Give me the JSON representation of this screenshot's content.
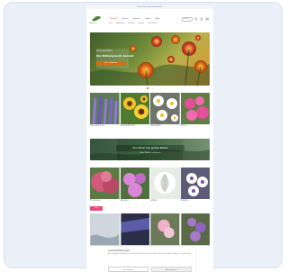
{
  "topbar": {
    "text": "Kostenloser Versand ab 50€"
  },
  "header": {
    "logo_text": "Gärtnerei",
    "nav": [
      {
        "label": "Pflanzen",
        "active": true
      },
      {
        "label": "Samen",
        "active": false
      },
      {
        "label": "Zubehör",
        "active": false
      },
      {
        "label": "Garten",
        "active": false
      },
      {
        "label": "Blog",
        "active": false
      }
    ],
    "subnav": [
      {
        "label": "Neu"
      },
      {
        "label": "Angebote"
      },
      {
        "label": "Beliebt"
      },
      {
        "label": "Saison"
      },
      {
        "label": "Geschenke"
      }
    ],
    "search_placeholder": "Suche…"
  },
  "hero": {
    "subtitle": "Sommerblüher",
    "title": "Die Blütenpracht kommt",
    "button_label": "Jetzt entdecken",
    "dots": [
      true,
      false,
      false
    ]
  },
  "grid_a": [
    {
      "label": "Lavendel & Co. ›"
    },
    {
      "label": "Sonnenblumen ›"
    },
    {
      "label": "Margeriten ›"
    },
    {
      "label": "Phlox ›"
    }
  ],
  "banner": {
    "title": "Die Gärten des großen Weltes",
    "subtitle": "Neue Pflanzen entdecken"
  },
  "grid_b": [
    {
      "label": "Hortensien ›"
    },
    {
      "label": "Stauden ›"
    },
    {
      "label": "Gräser ›"
    },
    {
      "label": "Dahlien ›"
    }
  ],
  "pill": {
    "label": "Top"
  },
  "cookie": {
    "title": "Cookie-Einstellungen",
    "text": "Wir verwenden Cookies, um dir das beste Einkaufserlebnis zu bieten. Mit Klick auf „Alle akzeptieren“ stimmst du zu.",
    "secondary_label": "Einstellungen",
    "primary_label": "Alle akzeptieren"
  },
  "colors": {
    "accent": "#d86d18",
    "pill": "#e54d7a"
  },
  "icons": {
    "search": "search-icon",
    "account": "user-icon",
    "cart": "cart-icon",
    "chevron": "chevron-right-icon",
    "logo": "leaf-logo-icon"
  }
}
